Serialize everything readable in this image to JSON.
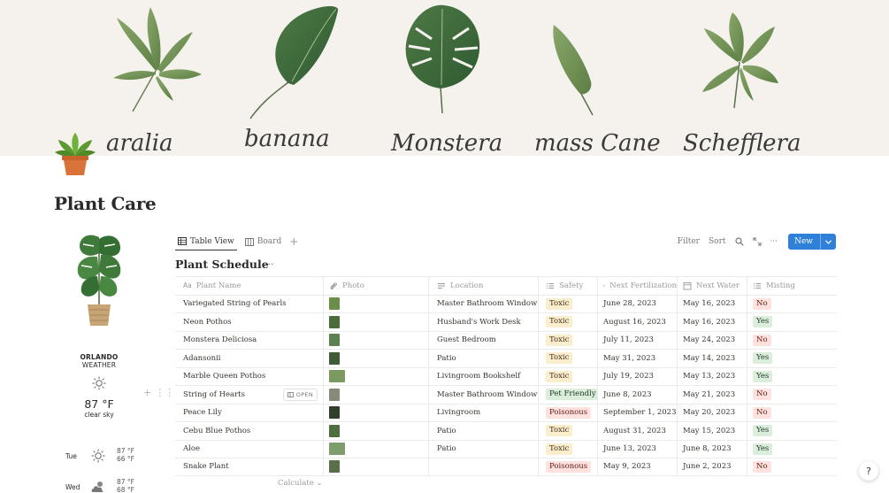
{
  "cover": {
    "plant_labels": [
      "aralia",
      "banana",
      "Monstera",
      "mass Cane",
      "Schefflera"
    ]
  },
  "page": {
    "title": "Plant Care"
  },
  "weather": {
    "city": "ORLANDO",
    "label": "WEATHER",
    "current_icon": "sun-icon",
    "temp": "87 °F",
    "desc": "clear sky",
    "forecast": [
      {
        "day": "Tue",
        "icon": "sun-icon",
        "hi": "87 °F",
        "lo": "66 °F"
      },
      {
        "day": "Wed",
        "icon": "partly-cloudy-icon",
        "hi": "87 °F",
        "lo": "68 °F"
      }
    ]
  },
  "toolbar": {
    "tabs": [
      {
        "label": "Table View",
        "icon": "table-icon",
        "active": true
      },
      {
        "label": "Board",
        "icon": "board-icon",
        "active": false
      }
    ],
    "add_view": "+",
    "filter": "Filter",
    "sort": "Sort",
    "more": "···",
    "new_label": "New"
  },
  "view": {
    "title": "Plant Schedule",
    "more": "···"
  },
  "table": {
    "columns": [
      {
        "label": "Plant Name",
        "icon": "text-aa-icon"
      },
      {
        "label": "Photo",
        "icon": "paperclip-icon"
      },
      {
        "label": "Location",
        "icon": "text-lines-icon"
      },
      {
        "label": "Safety",
        "icon": "list-icon"
      },
      {
        "label": "Next Fertilization",
        "icon": "calendar-icon"
      },
      {
        "label": "Next Water",
        "icon": "calendar-icon"
      },
      {
        "label": "Misting",
        "icon": "list-icon"
      }
    ],
    "rows": [
      {
        "name": "Variegated String of Pearls",
        "location": "Master Bathroom Window",
        "safety": "Toxic",
        "fert": "June 28, 2023",
        "water": "May 16, 2023",
        "misting": "No"
      },
      {
        "name": "Neon Pothos",
        "location": "Husband's Work Desk",
        "safety": "Toxic",
        "fert": "August 16, 2023",
        "water": "May 16, 2023",
        "misting": "Yes"
      },
      {
        "name": "Monstera Deliciosa",
        "location": "Guest Bedroom",
        "safety": "Toxic",
        "fert": "July 11, 2023",
        "water": "May 24, 2023",
        "misting": "No"
      },
      {
        "name": "Adansonii",
        "location": "Patio",
        "safety": "Toxic",
        "fert": "May 31, 2023",
        "water": "May 14, 2023",
        "misting": "Yes"
      },
      {
        "name": "Marble Queen Pothos",
        "location": "Livingroom Bookshelf",
        "safety": "Toxic",
        "fert": "July 19, 2023",
        "water": "May 13, 2023",
        "misting": "Yes"
      },
      {
        "name": "String of Hearts",
        "location": "Master Bathroom Window",
        "safety": "Pet Friendly",
        "fert": "June 8, 2023",
        "water": "May 21, 2023",
        "misting": "No"
      },
      {
        "name": "Peace Lily",
        "location": "Livingroom",
        "safety": "Poisonous",
        "fert": "September 1, 2023",
        "water": "May 20, 2023",
        "misting": "No"
      },
      {
        "name": "Cebu Blue Pothos",
        "location": "Patio",
        "safety": "Toxic",
        "fert": "August 31, 2023",
        "water": "May 15, 2023",
        "misting": "Yes"
      },
      {
        "name": "Aloe",
        "location": "Patio",
        "safety": "Toxic",
        "fert": "June 13, 2023",
        "water": "June 8, 2023",
        "misting": "Yes"
      },
      {
        "name": "Snake Plant",
        "location": "",
        "safety": "Poisonous",
        "fert": "May 9, 2023",
        "water": "June 2, 2023",
        "misting": "No"
      }
    ],
    "open_label": "OPEN",
    "calculate_label": "Calculate"
  },
  "help_label": "?",
  "colors": {
    "accent": "#2f80d9",
    "tag_toxic": "#fbeecc",
    "tag_pet_friendly": "#dbeddb",
    "tag_poisonous": "#ffe2dd",
    "tag_yes": "#dbeddb",
    "tag_no": "#ffe2dd"
  }
}
